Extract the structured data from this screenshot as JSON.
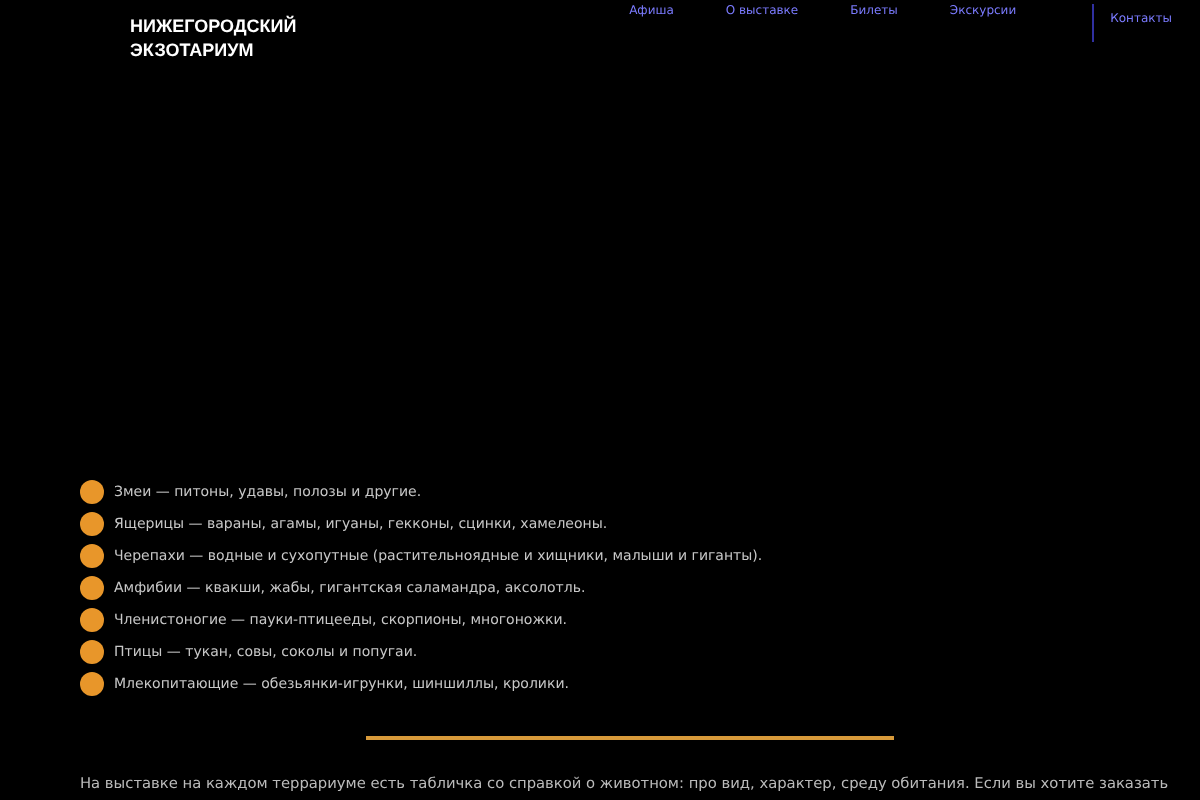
{
  "logo": {
    "lines": [
      "НИЖЕГОРОДСКИЙ",
      "ЭКЗОТАРИУМ"
    ]
  },
  "nav": [
    {
      "label": "Афиша",
      "selected": false
    },
    {
      "label": "О выставке",
      "selected": false
    },
    {
      "label": "Билеты",
      "selected": false
    },
    {
      "label": "Экскурсии",
      "selected": false
    },
    {
      "label": "Контакты",
      "selected": true
    }
  ],
  "animals": [
    "Змеи — питоны, удавы, полозы и другие.",
    "Ящерицы — вараны, агамы, игуаны, гекконы, сцинки, хамелеоны.",
    "Черепахи — водные и сухопутные (растительноядные и хищники, малыши и гиганты).",
    "Амфибии — квакши, жабы, гигантская саламандра, аксолотль.",
    "Членистоногие — пауки-птицееды, скорпионы, многоножки.",
    "Птицы — тукан, совы, соколы и попугаи.",
    "Млекопитающие — обезьянки-игрунки, шиншиллы, кролики."
  ],
  "note": "На выставке на каждом террариуме есть табличка со справкой о животном: про вид, характер, среду обитания. Если вы хотите заказать"
}
